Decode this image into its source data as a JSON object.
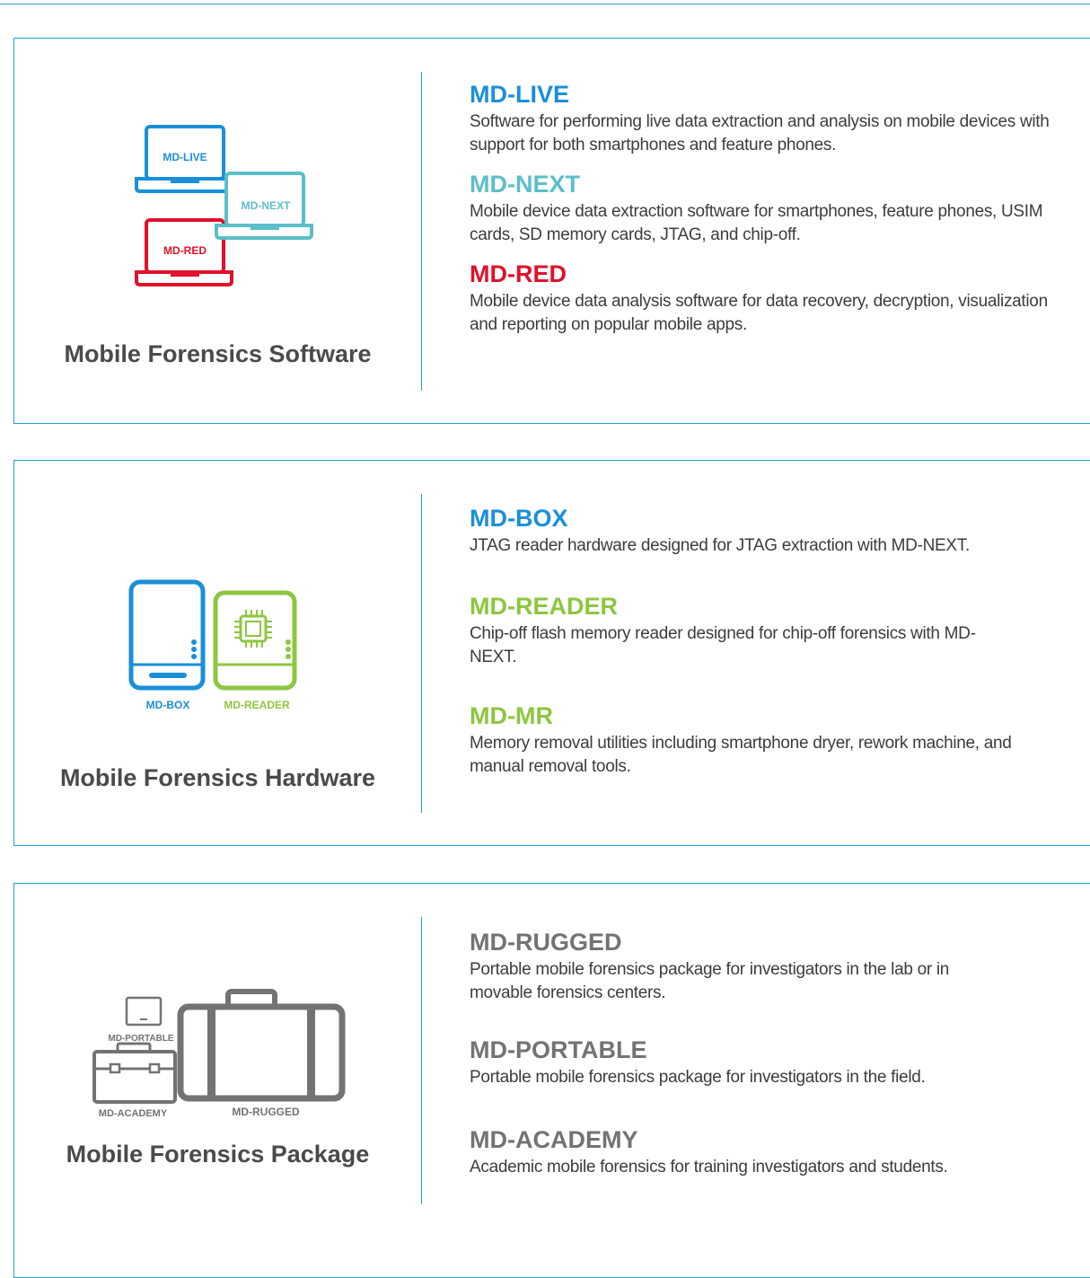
{
  "colors": {
    "border_blue": "#2a9bd6",
    "live_blue": "#1a8fd9",
    "next_teal": "#5bbfc9",
    "red": "#e0112b",
    "green": "#8dc63f",
    "gray": "#737373"
  },
  "software": {
    "title": "Mobile Forensics Software",
    "illustration": {
      "live": "MD-LIVE",
      "next": "MD-NEXT",
      "red": "MD-RED"
    },
    "items": [
      {
        "name": "MD-LIVE",
        "desc": "Software for performing live data extraction and analysis on mobile devices with support for both smartphones and feature phones."
      },
      {
        "name": "MD-NEXT",
        "desc": "Mobile device data extraction software for smartphones, feature phones, USIM cards, SD memory cards, JTAG, and chip-off."
      },
      {
        "name": "MD-RED",
        "desc": "Mobile device data analysis software for data recovery, decryption, visualization and reporting on popular mobile apps."
      }
    ]
  },
  "hardware": {
    "title": "Mobile Forensics Hardware",
    "illustration": {
      "box": "MD-BOX",
      "reader": "MD-READER"
    },
    "items": [
      {
        "name": "MD-BOX",
        "desc": "JTAG reader hardware designed for JTAG extraction with MD-NEXT."
      },
      {
        "name": "MD-READER",
        "desc": "Chip-off flash memory reader designed for chip-off forensics with MD-NEXT."
      },
      {
        "name": "MD-MR",
        "desc": "Memory removal utilities including smartphone dryer, rework machine, and manual removal tools."
      }
    ]
  },
  "package": {
    "title": "Mobile Forensics Package",
    "illustration": {
      "portable": "MD-PORTABLE",
      "academy": "MD-ACADEMY",
      "rugged": "MD-RUGGED"
    },
    "items": [
      {
        "name": "MD-RUGGED",
        "desc": "Portable mobile forensics package for investigators in the lab or in movable forensics centers."
      },
      {
        "name": "MD-PORTABLE",
        "desc": "Portable mobile forensics package for investigators in the field."
      },
      {
        "name": "MD-ACADEMY",
        "desc": "Academic mobile forensics for training investigators and students."
      }
    ]
  }
}
